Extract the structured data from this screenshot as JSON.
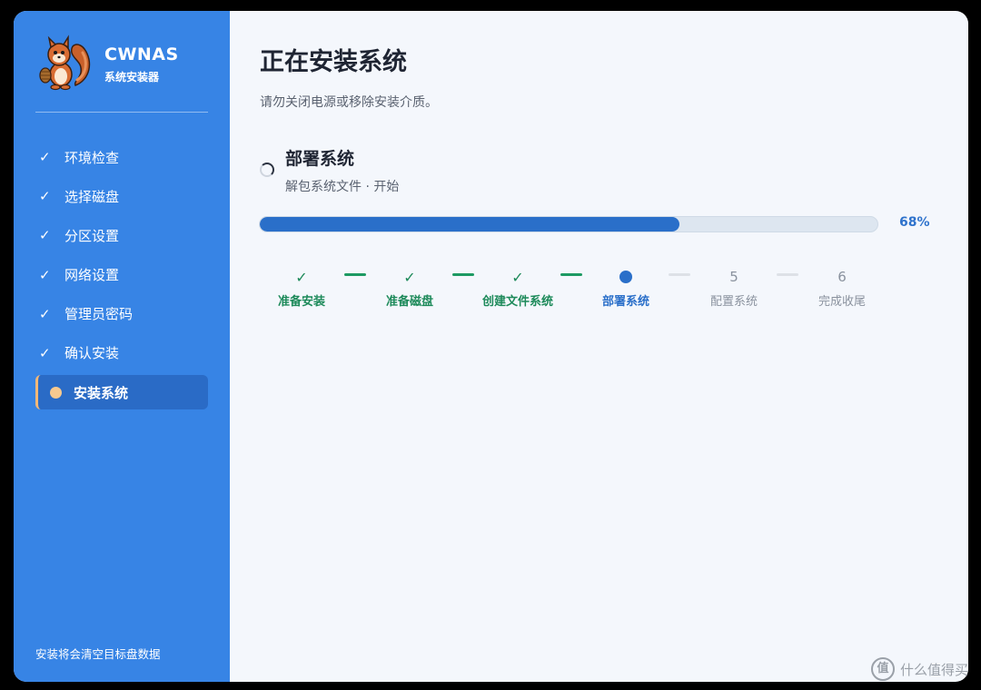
{
  "brand": {
    "name": "CWNAS",
    "subtitle": "系统安装器"
  },
  "sidebar": {
    "check_glyph": "✓",
    "items": [
      {
        "label": "环境检查",
        "state": "done"
      },
      {
        "label": "选择磁盘",
        "state": "done"
      },
      {
        "label": "分区设置",
        "state": "done"
      },
      {
        "label": "网络设置",
        "state": "done"
      },
      {
        "label": "管理员密码",
        "state": "done"
      },
      {
        "label": "确认安装",
        "state": "done"
      },
      {
        "label": "安装系统",
        "state": "active"
      }
    ],
    "footer_note": "安装将会清空目标盘数据"
  },
  "main": {
    "title": "正在安装系统",
    "subtitle": "请勿关闭电源或移除安装介质。",
    "phase": {
      "title": "部署系统",
      "detail": "解包系统文件 · 开始"
    },
    "progress": {
      "percent": 68,
      "label": "68%"
    },
    "timeline": [
      {
        "label": "准备安装",
        "state": "done",
        "mark": "✓"
      },
      {
        "label": "准备磁盘",
        "state": "done",
        "mark": "✓"
      },
      {
        "label": "创建文件系统",
        "state": "done",
        "mark": "✓"
      },
      {
        "label": "部署系统",
        "state": "current",
        "mark": ""
      },
      {
        "label": "配置系统",
        "state": "pending",
        "mark": "5"
      },
      {
        "label": "完成收尾",
        "state": "pending",
        "mark": "6"
      }
    ]
  },
  "watermark": {
    "text": "什么值得买",
    "icon": "值"
  },
  "colors": {
    "sidebar": "#3784e5",
    "accent": "#2a6fc9",
    "success": "#1d8a5a",
    "active_dot": "#f7c98f"
  }
}
